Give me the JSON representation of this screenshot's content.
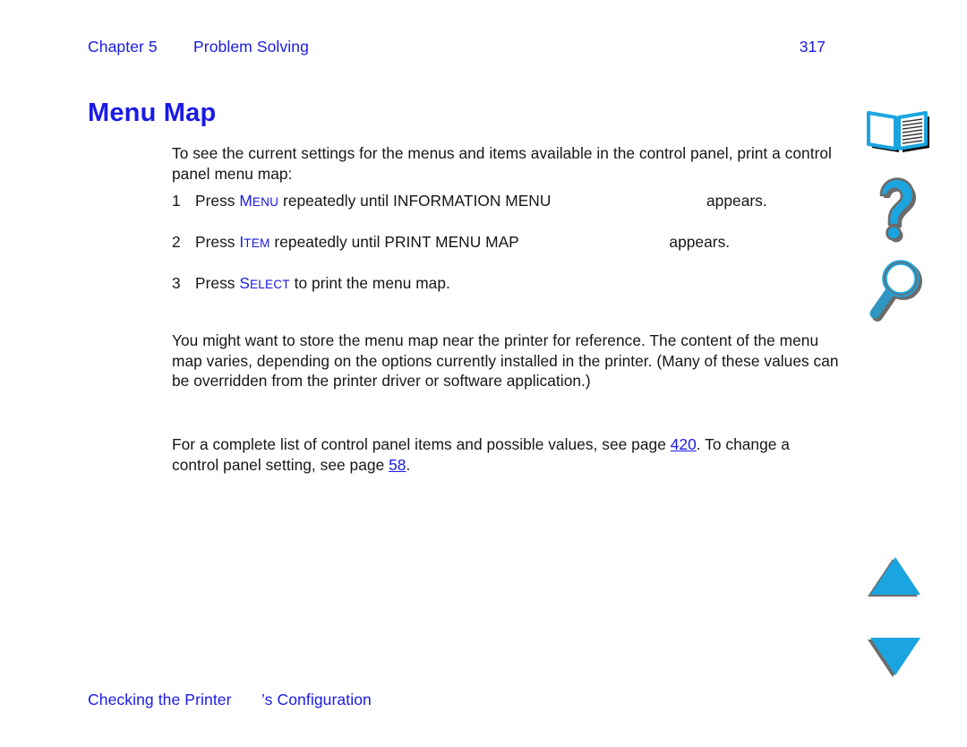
{
  "header": {
    "chapter_label": "Chapter 5",
    "chapter_title": "Problem Solving",
    "page_number": "317"
  },
  "section": {
    "heading": "Menu Map"
  },
  "body": {
    "intro_paragraph": "To see the current settings for the menus and items available in the control panel, print a control panel menu map:",
    "steps": [
      {
        "number": "1",
        "lead": "Press",
        "key_cap": "M",
        "key_rest": "ENU",
        "middle": "repeatedly until INFORMATION MENU",
        "tail": "appears."
      },
      {
        "number": "2",
        "lead": "Press",
        "key_cap": "I",
        "key_rest": "TEM",
        "middle": "repeatedly until PRINT MENU MAP",
        "tail": "appears."
      },
      {
        "number": "3",
        "lead": "Press",
        "key_cap": "S",
        "key_rest": "ELECT",
        "middle": "to print the menu map.",
        "tail": ""
      }
    ],
    "note_paragraph": "You might want to store the menu map near the printer for reference. The content of the menu map varies, depending on the options currently installed in the printer. (Many of these values can be overridden from the printer driver or software application.)",
    "reference_lead": "For a complete list of control panel items and possible values, see page ",
    "reference_link_1": "420",
    "reference_mid": ". To change a control panel setting, see page ",
    "reference_link_2": "58",
    "reference_end": "."
  },
  "footer": {
    "text_left": "Checking the Printer",
    "text_right": "’s Configuration"
  },
  "rail": {
    "items": [
      {
        "name": "book",
        "label": "Table of Contents"
      },
      {
        "name": "help",
        "label": "Help"
      },
      {
        "name": "find",
        "label": "Find"
      },
      {
        "name": "prev",
        "label": "Previous Page"
      },
      {
        "name": "next",
        "label": "Next Page"
      }
    ]
  },
  "colors": {
    "link_blue": "#1a1ae6",
    "icon_cyan": "#1ba5e0",
    "icon_outline": "#6b6b6b",
    "body_text": "#161616",
    "page_background": "#ffffff"
  }
}
